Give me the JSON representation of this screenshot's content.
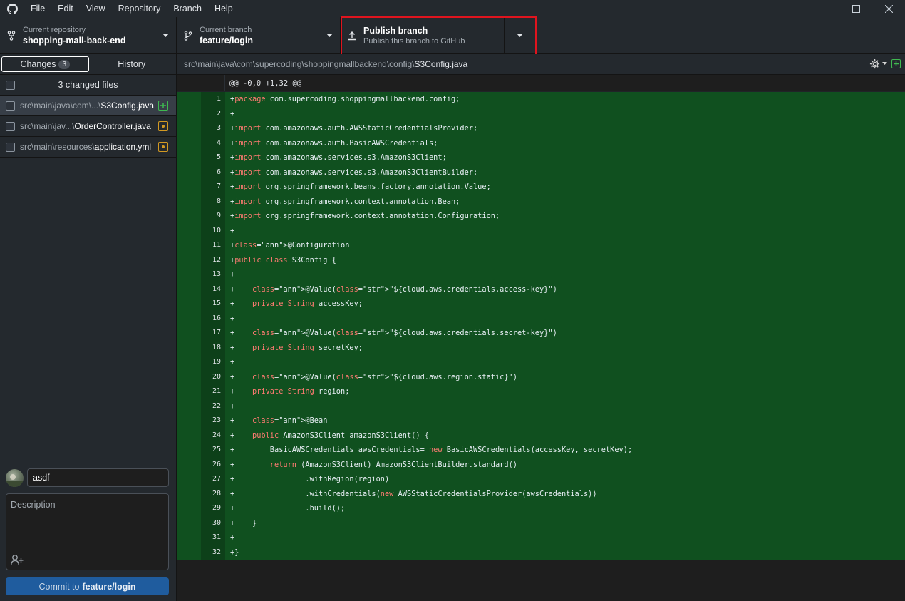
{
  "menu": [
    "File",
    "Edit",
    "View",
    "Repository",
    "Branch",
    "Help"
  ],
  "toolbar": {
    "repo_label": "Current repository",
    "repo_name": "shopping-mall-back-end",
    "branch_label": "Current branch",
    "branch_name": "feature/login",
    "publish_title": "Publish branch",
    "publish_subtitle": "Publish this branch to GitHub"
  },
  "sidebar": {
    "tabs": {
      "changes": "Changes",
      "changes_count": "3",
      "history": "History"
    },
    "changed_files_header": "3 changed files",
    "files": [
      {
        "dir": "src\\main\\java\\com\\...\\",
        "name": "S3Config.java",
        "status": "added"
      },
      {
        "dir": "src\\main\\jav...\\",
        "name": "OrderController.java",
        "status": "modified"
      },
      {
        "dir": "src\\main\\resources\\",
        "name": "application.yml",
        "status": "modified"
      }
    ]
  },
  "commit": {
    "summary": "asdf",
    "description_placeholder": "Description",
    "button_prefix": "Commit to",
    "button_branch": "feature/login"
  },
  "diff": {
    "path_prefix": "src\\main\\java\\com\\supercoding\\shoppingmallbackend\\config\\",
    "path_file": "S3Config.java",
    "hunk": "@@ -0,0 +1,32 @@",
    "lines": [
      {
        "n": "1",
        "t": "+package com.supercoding.shoppingmallbackend.config;"
      },
      {
        "n": "2",
        "t": "+"
      },
      {
        "n": "3",
        "t": "+import com.amazonaws.auth.AWSStaticCredentialsProvider;"
      },
      {
        "n": "4",
        "t": "+import com.amazonaws.auth.BasicAWSCredentials;"
      },
      {
        "n": "5",
        "t": "+import com.amazonaws.services.s3.AmazonS3Client;"
      },
      {
        "n": "6",
        "t": "+import com.amazonaws.services.s3.AmazonS3ClientBuilder;"
      },
      {
        "n": "7",
        "t": "+import org.springframework.beans.factory.annotation.Value;"
      },
      {
        "n": "8",
        "t": "+import org.springframework.context.annotation.Bean;"
      },
      {
        "n": "9",
        "t": "+import org.springframework.context.annotation.Configuration;"
      },
      {
        "n": "10",
        "t": "+"
      },
      {
        "n": "11",
        "t": "+@Configuration"
      },
      {
        "n": "12",
        "t": "+public class S3Config {"
      },
      {
        "n": "13",
        "t": "+"
      },
      {
        "n": "14",
        "t": "+    @Value(\"${cloud.aws.credentials.access-key}\")"
      },
      {
        "n": "15",
        "t": "+    private String accessKey;"
      },
      {
        "n": "16",
        "t": "+"
      },
      {
        "n": "17",
        "t": "+    @Value(\"${cloud.aws.credentials.secret-key}\")"
      },
      {
        "n": "18",
        "t": "+    private String secretKey;"
      },
      {
        "n": "19",
        "t": "+"
      },
      {
        "n": "20",
        "t": "+    @Value(\"${cloud.aws.region.static}\")"
      },
      {
        "n": "21",
        "t": "+    private String region;"
      },
      {
        "n": "22",
        "t": "+"
      },
      {
        "n": "23",
        "t": "+    @Bean"
      },
      {
        "n": "24",
        "t": "+    public AmazonS3Client amazonS3Client() {"
      },
      {
        "n": "25",
        "t": "+        BasicAWSCredentials awsCredentials= new BasicAWSCredentials(accessKey, secretKey);"
      },
      {
        "n": "26",
        "t": "+        return (AmazonS3Client) AmazonS3ClientBuilder.standard()"
      },
      {
        "n": "27",
        "t": "+                .withRegion(region)"
      },
      {
        "n": "28",
        "t": "+                .withCredentials(new AWSStaticCredentialsProvider(awsCredentials))"
      },
      {
        "n": "29",
        "t": "+                .build();"
      },
      {
        "n": "30",
        "t": "+    }"
      },
      {
        "n": "31",
        "t": "+"
      },
      {
        "n": "32",
        "t": "+}"
      }
    ]
  },
  "colors": {
    "added_bg": "#10501f",
    "highlight": "#e0141e",
    "commit_button": "#1f5c9e"
  }
}
